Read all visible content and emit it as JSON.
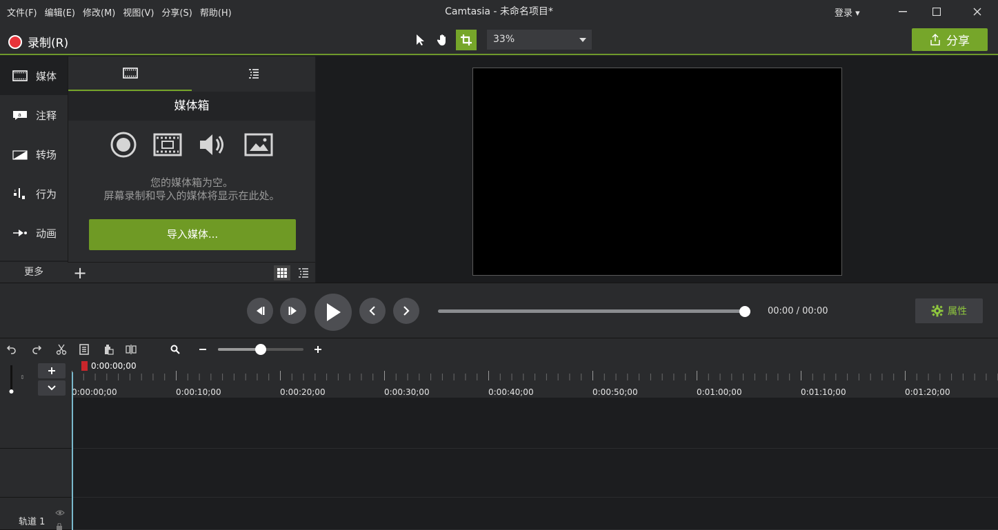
{
  "menu": [
    "文件(F)",
    "编辑(E)",
    "修改(M)",
    "视图(V)",
    "分享(S)",
    "帮助(H)"
  ],
  "window_title": "Camtasia - 未命名项目*",
  "login_label": "登录 ▾",
  "record_label": "录制(R)",
  "zoom_value": "33%",
  "share_label": "分享",
  "nav": {
    "media": "媒体",
    "annotations": "注释",
    "transitions": "转场",
    "behaviors": "行为",
    "animations": "动画",
    "more": "更多"
  },
  "media_bin": {
    "title": "媒体箱",
    "empty_line1": "您的媒体箱为空。",
    "empty_line2": "屏幕录制和导入的媒体将显示在此处。",
    "import_label": "导入媒体..."
  },
  "playback": {
    "time": "00:00 / 00:00",
    "position_fraction": 1.0,
    "properties_label": "属性"
  },
  "timeline": {
    "zoom_fraction": 0.5,
    "playhead_time": "0:00:00;00",
    "tick_labels": [
      "0:00:00;00",
      "0:00:10;00",
      "0:00:20;00",
      "0:00:30;00",
      "0:00:40;00",
      "0:00:50;00",
      "0:01:00;00",
      "0:01:10;00",
      "0:01:20;00"
    ],
    "track_label": "轨道 1"
  },
  "colors": {
    "accent": "#76a62a",
    "record": "#e8333a",
    "properties_text": "#8fc73e"
  }
}
